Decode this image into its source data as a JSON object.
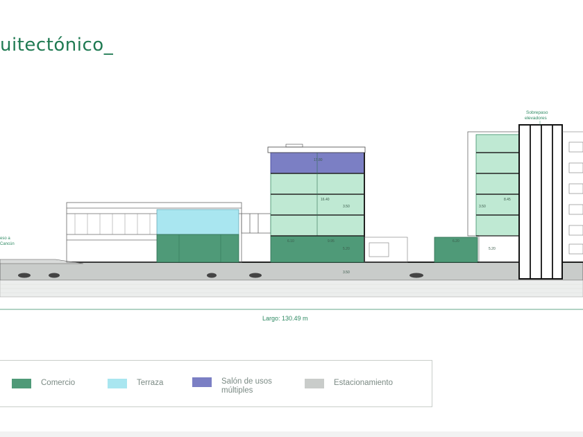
{
  "title": "uitectónico_",
  "labels": {
    "sobrepaso": "Sobrepaso\nelevadores",
    "left_note": "eso a\nCancún",
    "largo": "Largo: 130.49 m"
  },
  "dimensions": [
    "17.80",
    "16.40",
    "3.50",
    "6.10",
    "9.95",
    "5.20",
    "6.20",
    "8.45",
    "3.50",
    "5.20",
    "3.50"
  ],
  "legend": [
    {
      "label": "Comercio",
      "color": "#4f9a78",
      "icon": "swatch-comercio"
    },
    {
      "label": "Terraza",
      "color": "#a9e6f0",
      "icon": "swatch-terraza"
    },
    {
      "label": "Salón de usos\nmúltiples",
      "color": "#7b7fc4",
      "icon": "swatch-salon"
    },
    {
      "label": "Estacionamiento",
      "color": "#c9ccca",
      "icon": "swatch-estacionamiento"
    }
  ]
}
